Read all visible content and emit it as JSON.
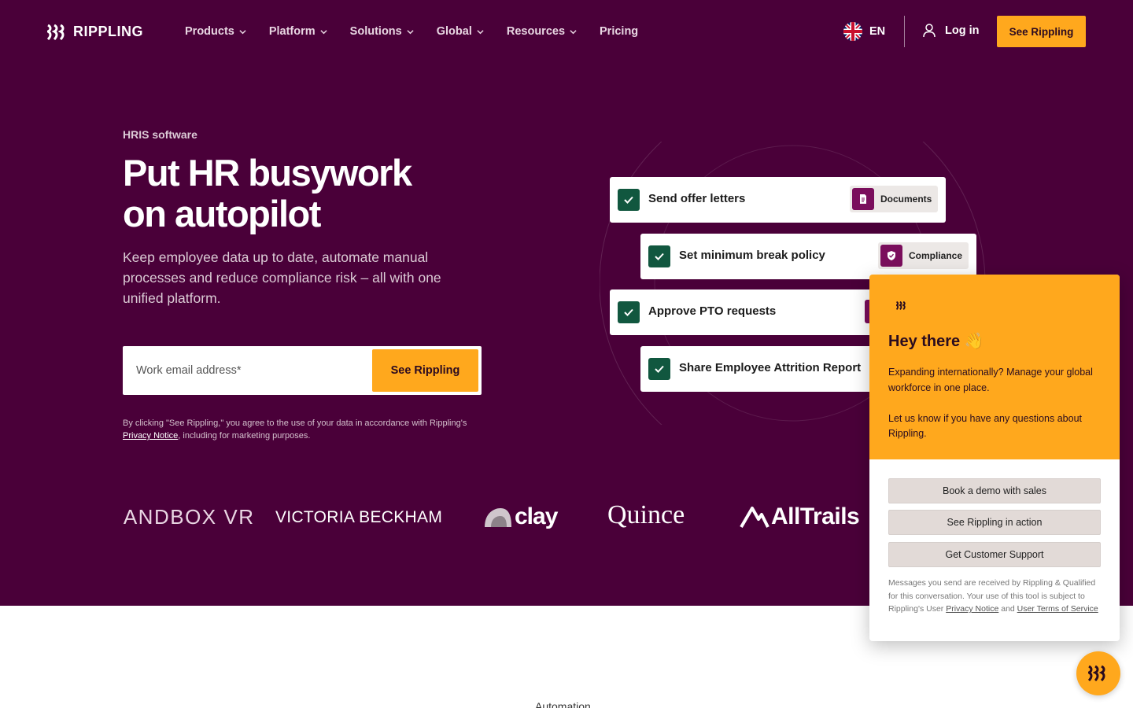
{
  "nav": {
    "logo_text": "RIPPLING",
    "items": [
      {
        "label": "Products",
        "has_dropdown": true
      },
      {
        "label": "Platform",
        "has_dropdown": true
      },
      {
        "label": "Solutions",
        "has_dropdown": true
      },
      {
        "label": "Global",
        "has_dropdown": true
      },
      {
        "label": "Resources",
        "has_dropdown": true
      },
      {
        "label": "Pricing",
        "has_dropdown": false
      }
    ],
    "language": "EN",
    "login": "Log in",
    "cta": "See Rippling"
  },
  "hero": {
    "eyebrow": "HRIS software",
    "headline_line1": "Put HR busywork",
    "headline_line2": "on autopilot",
    "subhead": "Keep employee data up to date, automate manual processes and reduce compliance risk – all with one unified platform.",
    "email_placeholder": "Work email address*",
    "form_cta": "See Rippling",
    "legal_before": "By clicking \"See Rippling,\" you agree to the use of your data in accordance with Rippling's ",
    "legal_link": "Privacy Notice",
    "legal_after": ", including for marketing purposes."
  },
  "tasks": [
    {
      "label": "Send offer letters",
      "tag": "Documents",
      "tag_icon": "document-icon"
    },
    {
      "label": "Set minimum break policy",
      "tag": "Compliance",
      "tag_icon": "shield-icon"
    },
    {
      "label": "Approve PTO requests",
      "tag": "",
      "tag_icon": ""
    },
    {
      "label": "Share Employee Attrition Report",
      "tag": "",
      "tag_icon": ""
    }
  ],
  "logos": [
    "SANDBOX VR",
    "VICTORIA BECKHAM",
    "clay",
    "Quince",
    "AllTrails"
  ],
  "chat": {
    "greeting": "Hey there 👋",
    "message1": "Expanding internationally? Manage your global workforce in one place.",
    "message2": "Let us know if you have any questions about Rippling.",
    "buttons": [
      "Book a demo with sales",
      "See Rippling in action",
      "Get Customer Support"
    ],
    "footer_before": "Messages you send are received by Rippling & Qualified for this conversation. Your use of this tool is subject to Rippling's User ",
    "footer_link1": "Privacy Notice",
    "footer_mid": " and ",
    "footer_link2": "User Terms of Service"
  },
  "next_section_label": "Automation",
  "colors": {
    "hero_bg": "#4a0039",
    "accent": "#ffa81d",
    "check_green": "#11573f",
    "tag_icon": "#7a0e5c"
  }
}
